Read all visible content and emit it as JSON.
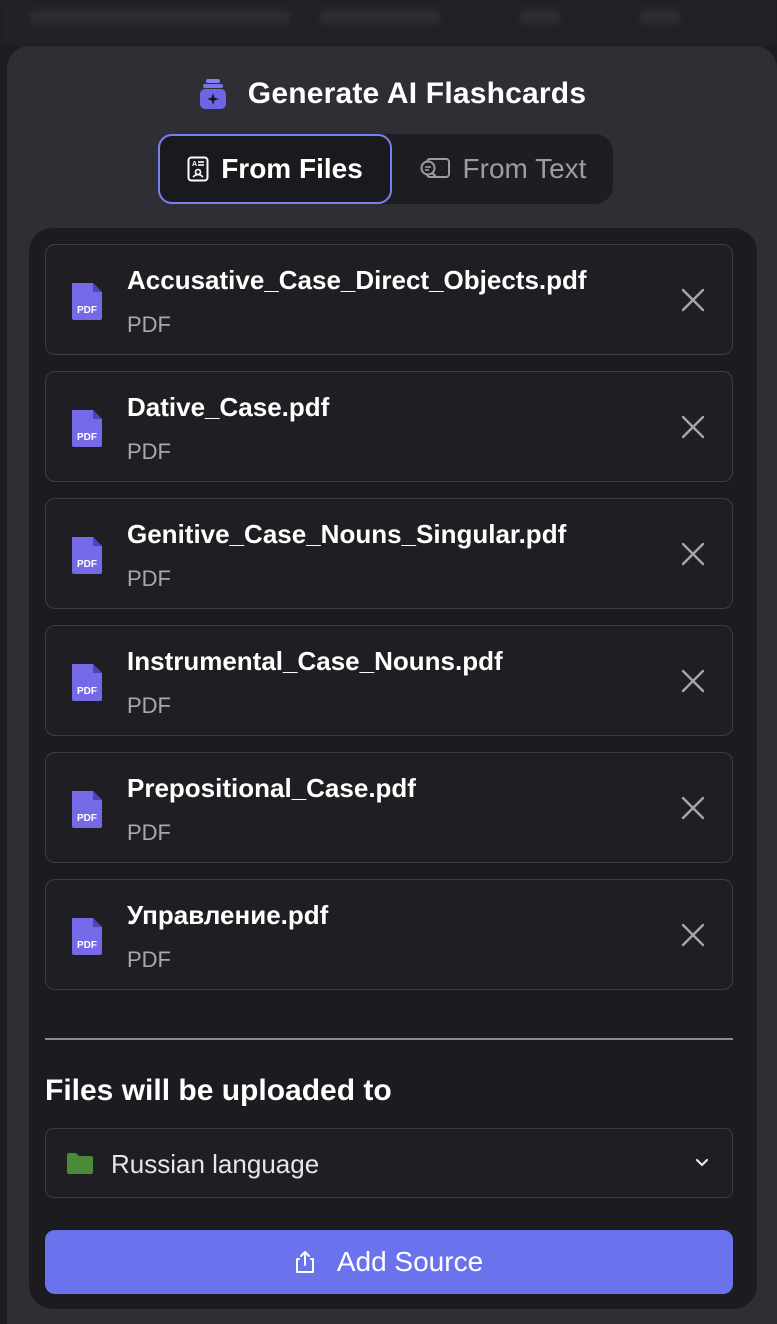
{
  "dialog": {
    "title": "Generate AI Flashcards",
    "logo_icon": "stack-sparkle-icon"
  },
  "tabs": [
    {
      "label": "From Files",
      "icon": "document-icon",
      "active": true
    },
    {
      "label": "From Text",
      "icon": "text-search-icon",
      "active": false
    }
  ],
  "files": [
    {
      "name": "Accusative_Case_Direct_Objects.pdf",
      "type": "PDF"
    },
    {
      "name": "Dative_Case.pdf",
      "type": "PDF"
    },
    {
      "name": "Genitive_Case_Nouns_Singular.pdf",
      "type": "PDF"
    },
    {
      "name": "Instrumental_Case_Nouns.pdf",
      "type": "PDF"
    },
    {
      "name": "Prepositional_Case.pdf",
      "type": "PDF"
    },
    {
      "name": "Управление.pdf",
      "type": "PDF"
    }
  ],
  "file_icon_label": "PDF",
  "upload": {
    "label": "Files will be uploaded to",
    "destination": "Russian language",
    "destination_icon": "folder-icon"
  },
  "add_button": {
    "label": "Add Source",
    "icon": "upload-icon"
  },
  "colors": {
    "accent": "#6b72ee",
    "folder": "#4b8a3a",
    "pdf_icon": "#7569e8"
  }
}
